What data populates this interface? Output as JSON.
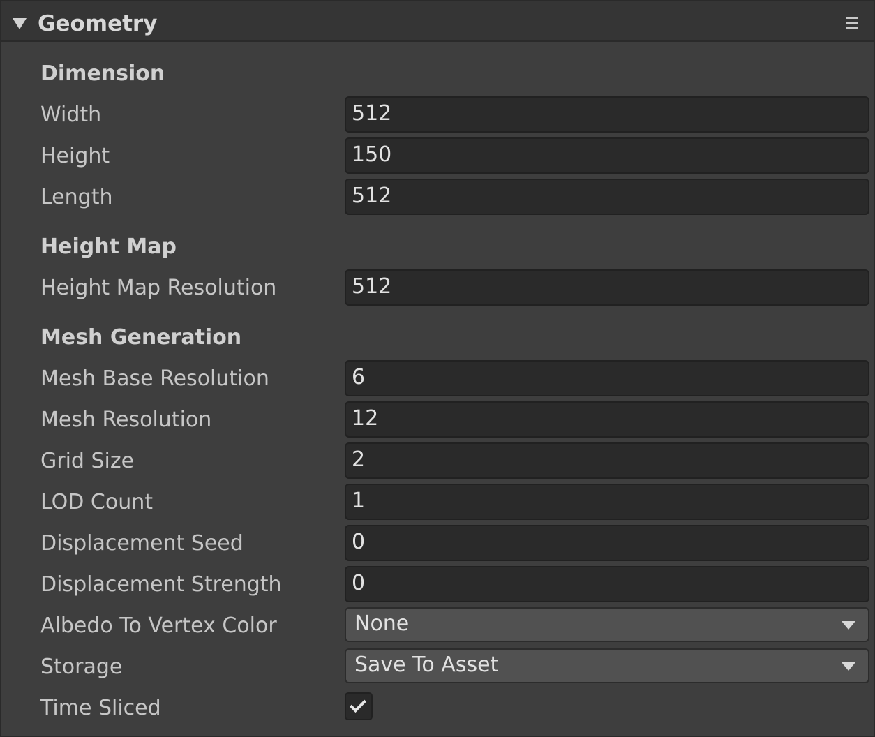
{
  "header": {
    "title": "Geometry",
    "menu_icon": "hamburger-menu-icon",
    "foldout_icon": "triangle-down-icon"
  },
  "dimension": {
    "title": "Dimension",
    "width": {
      "label": "Width",
      "value": "512"
    },
    "height": {
      "label": "Height",
      "value": "150"
    },
    "length": {
      "label": "Length",
      "value": "512"
    }
  },
  "height_map": {
    "title": "Height Map",
    "resolution": {
      "label": "Height Map Resolution",
      "value": "512"
    }
  },
  "mesh_generation": {
    "title": "Mesh Generation",
    "mesh_base_resolution": {
      "label": "Mesh Base Resolution",
      "value": "6"
    },
    "mesh_resolution": {
      "label": "Mesh Resolution",
      "value": "12"
    },
    "grid_size": {
      "label": "Grid Size",
      "value": "2"
    },
    "lod_count": {
      "label": "LOD Count",
      "value": "1"
    },
    "displacement_seed": {
      "label": "Displacement Seed",
      "value": "0"
    },
    "displacement_strength": {
      "label": "Displacement Strength",
      "value": "0"
    },
    "albedo_to_vertex_color": {
      "label": "Albedo To Vertex Color",
      "value": "None"
    },
    "storage": {
      "label": "Storage",
      "value": "Save To Asset"
    },
    "time_sliced": {
      "label": "Time Sliced",
      "checked": true
    }
  },
  "colors": {
    "panel_bg": "#3e3e3e",
    "header_bg": "#353535",
    "field_bg": "#2a2a2a",
    "dropdown_bg": "#515151",
    "text": "#c6c6c6"
  }
}
